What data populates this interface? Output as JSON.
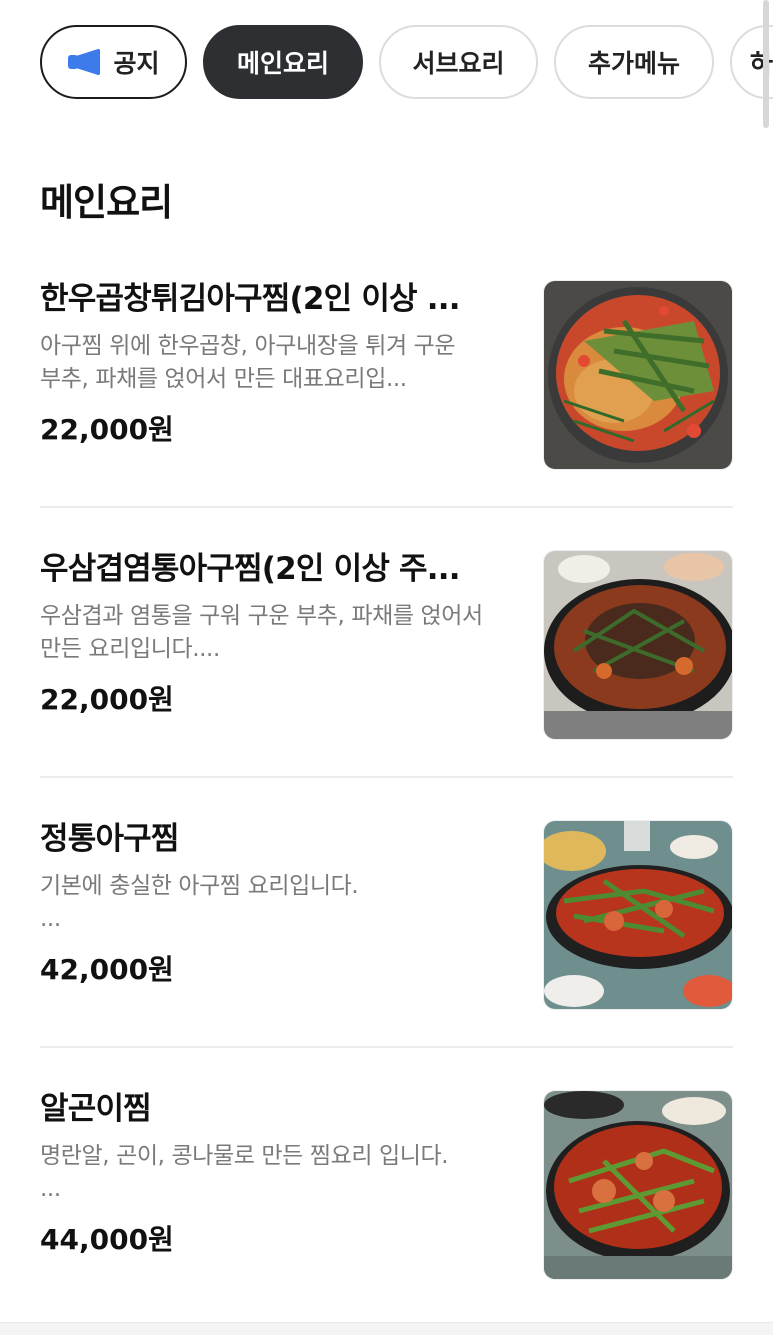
{
  "tabs": [
    {
      "label": "공지",
      "icon": "megaphone-icon",
      "state": "outlined"
    },
    {
      "label": "메인요리",
      "state": "selected"
    },
    {
      "label": "서브요리",
      "state": "default"
    },
    {
      "label": "추가메뉴",
      "state": "default"
    },
    {
      "label": "하",
      "state": "default"
    }
  ],
  "section": {
    "title": "메인요리"
  },
  "menu_items": [
    {
      "name": "한우곱창튀김아구찜(2인 이상 ...",
      "description": "아구찜 위에 한우곱창, 아구내장을 튀겨 구운 부추, 파채를 얹어서 만든 대표요리입...",
      "price": "22,000원"
    },
    {
      "name": "우삼겹염통아구찜(2인 이상 주...",
      "description": "우삼겹과 염통을 구워 구운 부추, 파채를 얹어서 만든 요리입니다....",
      "price": "22,000원"
    },
    {
      "name": "정통아구찜",
      "description": "기본에 충실한 아구찜 요리입니다.\n...",
      "price": "42,000원"
    },
    {
      "name": "알곤이찜",
      "description": "명란알, 곤이, 콩나물로 만든 찜요리 입니다.\n...",
      "price": "44,000원"
    }
  ],
  "colors": {
    "selected_tab_bg": "#2d2f33",
    "notice_icon": "#3d7bea",
    "description_text": "#7a7a7a",
    "divider": "#ececec"
  }
}
